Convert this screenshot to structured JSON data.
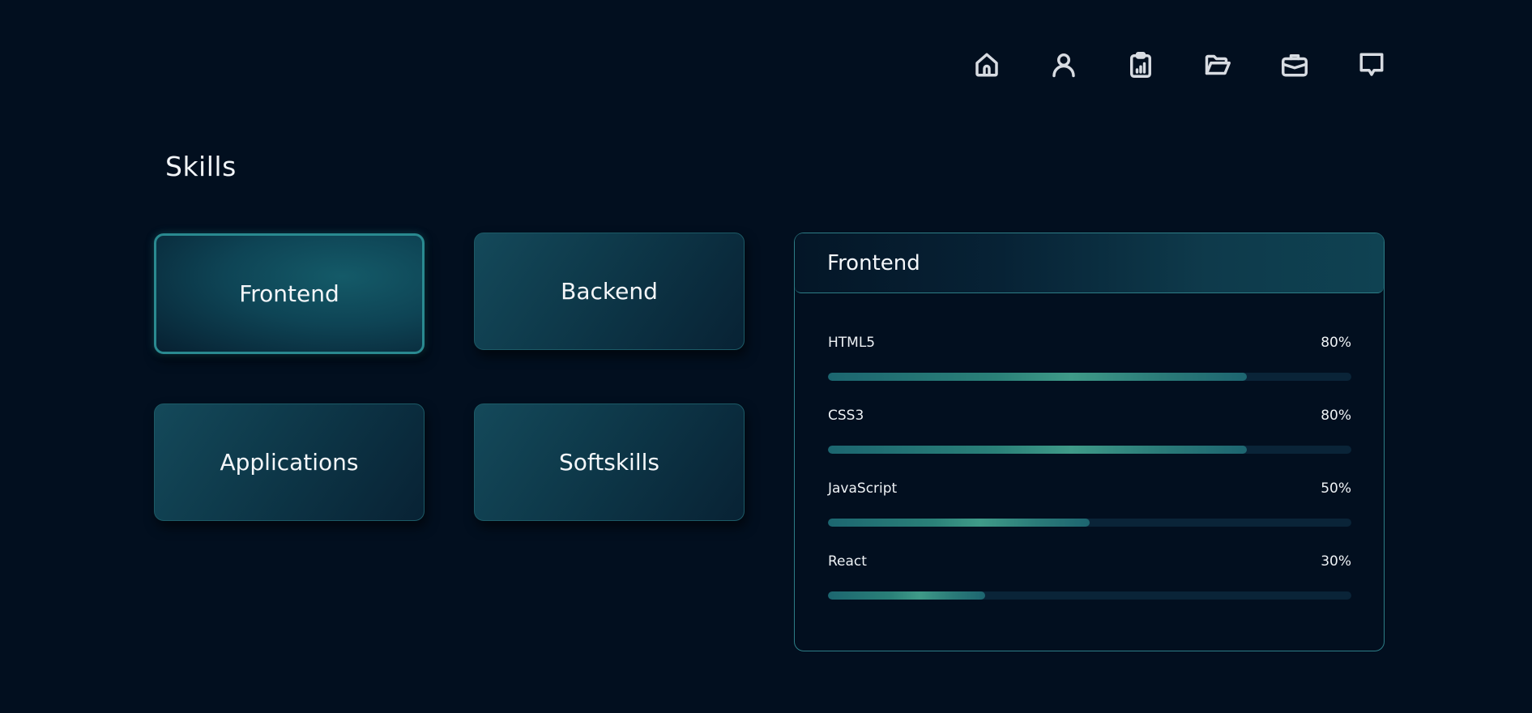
{
  "nav": {
    "items": [
      {
        "icon": "home-icon",
        "name": "nav-home"
      },
      {
        "icon": "user-icon",
        "name": "nav-about"
      },
      {
        "icon": "clipboard-chart-icon",
        "name": "nav-skills"
      },
      {
        "icon": "folder-open-icon",
        "name": "nav-projects"
      },
      {
        "icon": "briefcase-icon",
        "name": "nav-experience"
      },
      {
        "icon": "chat-icon",
        "name": "nav-contact"
      }
    ]
  },
  "page": {
    "title": "Skills"
  },
  "categories": [
    {
      "label": "Frontend",
      "active": true
    },
    {
      "label": "Backend",
      "active": false
    },
    {
      "label": "Applications",
      "active": false
    },
    {
      "label": "Softskills",
      "active": false
    }
  ],
  "panel": {
    "title": "Frontend",
    "skills": [
      {
        "name": "HTML5",
        "percent_label": "80%",
        "level": 0.8
      },
      {
        "name": "CSS3",
        "percent_label": "80%",
        "level": 0.8
      },
      {
        "name": "JavaScript",
        "percent_label": "50%",
        "level": 0.5
      },
      {
        "name": "React",
        "percent_label": "30%",
        "level": 0.3
      }
    ]
  },
  "colors": {
    "background": "#020f1f",
    "accent": "#2d7d86",
    "bar_fill": "#3f9a88",
    "bar_track": "#0a2438"
  }
}
